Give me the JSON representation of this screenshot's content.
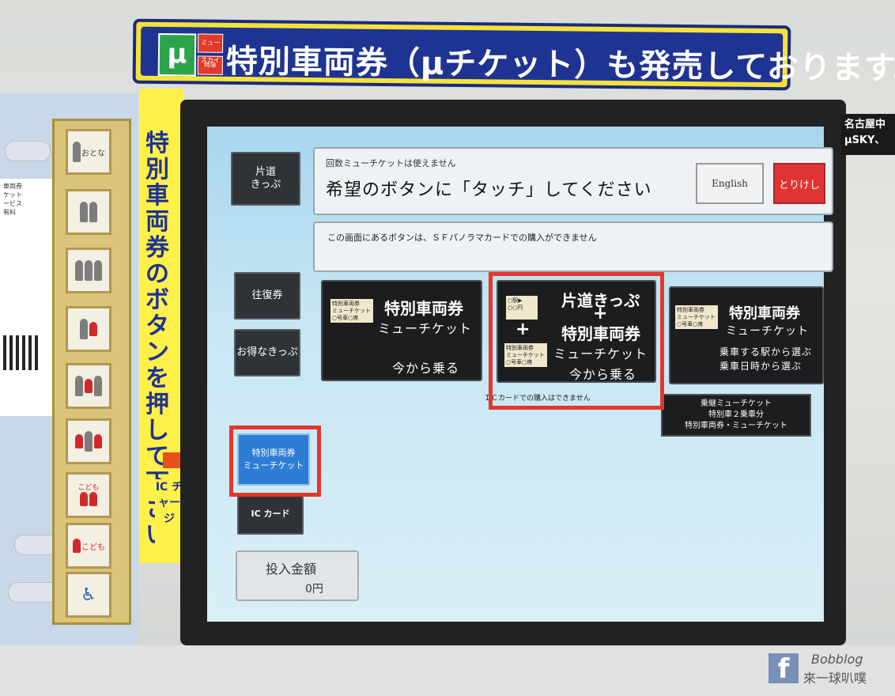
{
  "banner": {
    "logo_text": "μ",
    "badge_top": "ミュースカイ",
    "badge_bottom": "特急",
    "text": "特別車両券（μチケット）も発売しております。"
  },
  "left_panel": {
    "vertical_text": "特別車両券のボタンを押して下さい",
    "ic_charge": "IC チャージ",
    "white_card_lines": [
      "車両券",
      "ケット",
      "ービス",
      "有料"
    ],
    "fare_buttons": [
      "おとな",
      "",
      "",
      "",
      "",
      "",
      "こども",
      "こども",
      ""
    ]
  },
  "screen": {
    "side_buttons": {
      "one_way": "片道\nきっぷ",
      "round_trip": "往復券",
      "discount": "お得なきっぷ",
      "special_car": "特別車両券\nミューチケット",
      "ic_card": "IC カード"
    },
    "instruction": {
      "note": "回数ミューチケットは使えません",
      "main": "希望のボタンに「タッチ」してください",
      "english": "English",
      "cancel": "とりけし"
    },
    "sf_note": "この画面にあるボタンは、ＳＦパノラマカードでの購入ができません",
    "options": {
      "opt1": {
        "title": "特別車両券",
        "sub": "ミューチケット",
        "action": "今から乗る",
        "icon": "特別車両券\nミューチケット\n○号車○席"
      },
      "opt2": {
        "line1": "片道きっぷ",
        "plus": "+",
        "line2": "特別車両券",
        "sub": "ミューチケット",
        "action": "今から乗る",
        "icon_a": "○駅▶\n○○円",
        "icon_b": "特別車両券\nミューチケット\n○号車○席"
      },
      "opt3": {
        "title": "特別車両券",
        "sub": "ミューチケット",
        "line1": "乗車する駅から選ぶ",
        "line2": "乗車日時から選ぶ",
        "icon": "特別車両券\nミューチケット\n○号車○席"
      }
    },
    "ic_note": "ＩＣカードでの購入はできません",
    "multi_button": {
      "l1": "乗継ミューチケット",
      "l2": "特別車２乗車分",
      "l3": "特別車両券・ミューチケット"
    },
    "amount": {
      "label": "投入金額",
      "value": "0円"
    }
  },
  "corner_caption": {
    "l1": "名古屋中",
    "l2": "μSKY、"
  },
  "watermark": {
    "icon": "f",
    "l1": "Bobblog",
    "l2": "來一球叭噗"
  },
  "colors": {
    "banner_blue": "#1f3392",
    "banner_yellow": "#f4e23a",
    "highlight_red": "#e0382f",
    "cancel_red": "#e03434",
    "selected_blue": "#2d7dd6"
  }
}
